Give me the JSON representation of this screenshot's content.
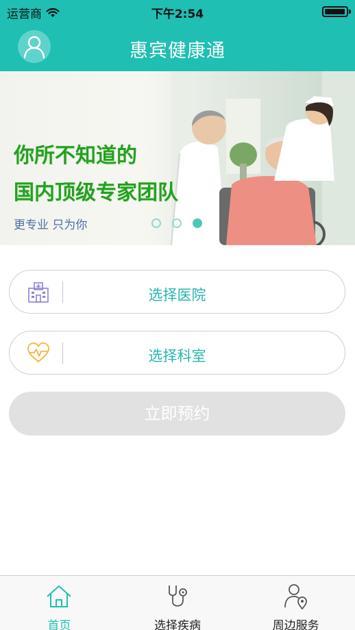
{
  "status_bar": {
    "carrier": "运营商",
    "time": "下午2:54",
    "battery_level": 0.95
  },
  "nav": {
    "title": "惠宾健康通",
    "avatar_icon": "user-avatar-icon"
  },
  "banner": {
    "headline_1": "你所不知道的",
    "headline_2": "国内顶级专家团队",
    "subline": "更专业 只为你",
    "slide_count": 3,
    "active_slide": 3
  },
  "form": {
    "hospital": {
      "label": "选择医院",
      "icon": "hospital-icon"
    },
    "department": {
      "label": "选择科室",
      "icon": "heartbeat-icon"
    },
    "book_button": "立即预约"
  },
  "tabs": [
    {
      "label": "首页",
      "icon": "home-icon",
      "active": true
    },
    {
      "label": "选择疾病",
      "icon": "stethoscope-icon",
      "active": false
    },
    {
      "label": "周边服务",
      "icon": "user-location-icon",
      "active": false
    }
  ],
  "colors": {
    "brand": "#1fbfb3",
    "label_accent": "#24b7ad",
    "disabled_button": "#e1e1e1",
    "banner_headline": "#24a021"
  }
}
